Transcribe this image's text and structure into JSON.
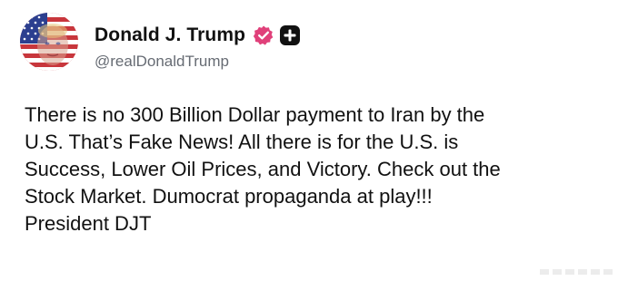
{
  "author": {
    "display_name": "Donald J. Trump",
    "handle": "@realDonaldTrump",
    "avatar_icon": "flag-portrait-avatar",
    "verified_icon": "verified-badge-icon",
    "verified_color": "#e0407a",
    "follow_icon": "plus-badge-icon"
  },
  "post": {
    "lines": [
      "There is no 300 Billion Dollar payment to Iran by the",
      "U.S. That’s Fake News! All there is for the U.S. is",
      "Success, Lower Oil Prices, and Victory. Check out the",
      "Stock Market. Dumocrat propaganda at play!!!",
      "President DJT"
    ]
  }
}
